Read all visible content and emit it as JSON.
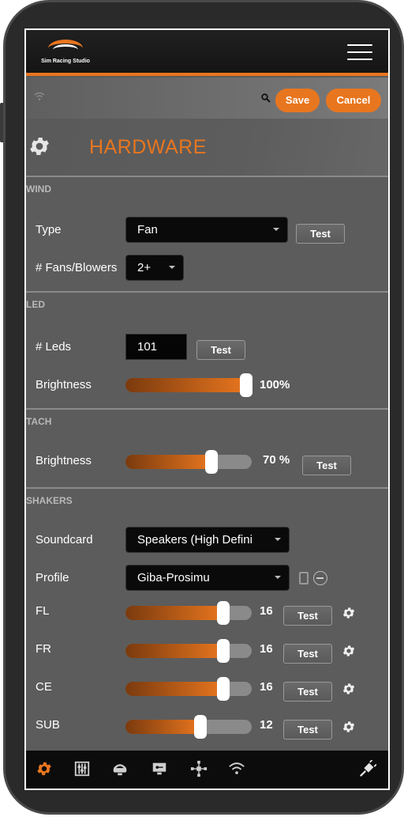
{
  "app": {
    "brand": "Sim Racing Studio",
    "accent_color": "#e8761f"
  },
  "actions": {
    "save_label": "Save",
    "cancel_label": "Cancel"
  },
  "page": {
    "title": "HARDWARE"
  },
  "wind": {
    "title": "WIND",
    "type_label": "Type",
    "type_value": "Fan",
    "test_label": "Test",
    "fans_label": "# Fans/Blowers",
    "fans_value": "2+"
  },
  "led": {
    "title": "LED",
    "leds_label": "# Leds",
    "leds_value": "101",
    "test_label": "Test",
    "brightness_label": "Brightness",
    "brightness_value": "100%",
    "brightness_level": 100
  },
  "tach": {
    "title": "TACH",
    "brightness_label": "Brightness",
    "brightness_value": "70 %",
    "brightness_level": 70,
    "test_label": "Test"
  },
  "shakers": {
    "title": "SHAKERS",
    "soundcard_label": "Soundcard",
    "soundcard_value": "Speakers (High Defini",
    "profile_label": "Profile",
    "profile_value": "Giba-Prosimu",
    "channels": [
      {
        "label": "FL",
        "value": "16",
        "level": 16,
        "max": 20,
        "test_label": "Test"
      },
      {
        "label": "FR",
        "value": "16",
        "level": 16,
        "max": 20,
        "test_label": "Test"
      },
      {
        "label": "CE",
        "value": "16",
        "level": 16,
        "max": 20,
        "test_label": "Test"
      },
      {
        "label": "SUB",
        "value": "12",
        "level": 12,
        "max": 20,
        "test_label": "Test"
      }
    ]
  },
  "bottom_nav": {
    "items": [
      "gear-icon",
      "mixer-icon",
      "headset-icon",
      "monitor-key-icon",
      "network-icon",
      "wifi-icon",
      "plug-icon"
    ]
  }
}
